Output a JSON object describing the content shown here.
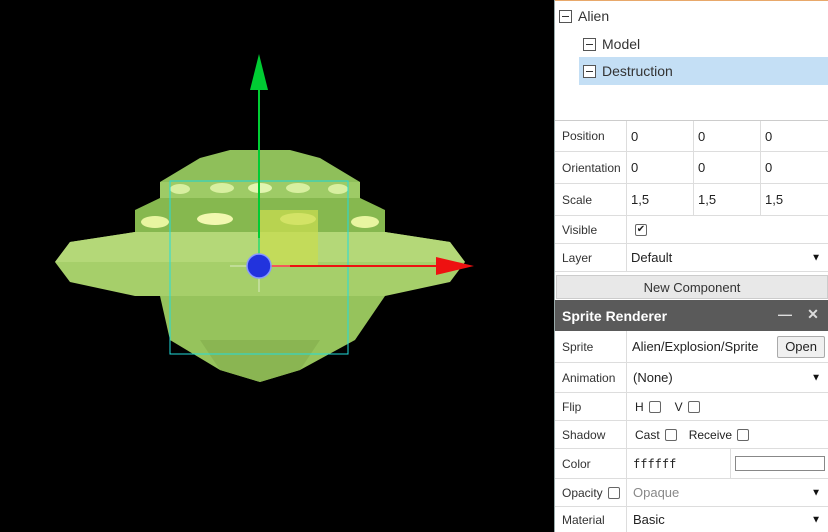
{
  "tree": {
    "items": [
      {
        "label": "Alien"
      },
      {
        "label": "Model"
      },
      {
        "label": "Destruction"
      }
    ]
  },
  "transform": {
    "position": {
      "label": "Position",
      "x": "0",
      "y": "0",
      "z": "0"
    },
    "orientation": {
      "label": "Orientation",
      "x": "0",
      "y": "0",
      "z": "0"
    },
    "scale": {
      "label": "Scale",
      "x": "1,5",
      "y": "1,5",
      "z": "1,5"
    },
    "visible": {
      "label": "Visible",
      "checked": true,
      "check_glyph": "✔"
    },
    "layer": {
      "label": "Layer",
      "value": "Default"
    }
  },
  "new_component_label": "New Component",
  "sprite_renderer": {
    "title": "Sprite Renderer",
    "minimize_glyph": "—",
    "close_glyph": "✕",
    "sprite": {
      "label": "Sprite",
      "value": "Alien/Explosion/Sprite",
      "open_label": "Open"
    },
    "animation": {
      "label": "Animation",
      "value": "(None)"
    },
    "flip": {
      "label": "Flip",
      "h_label": "H",
      "v_label": "V"
    },
    "shadow": {
      "label": "Shadow",
      "cast_label": "Cast",
      "receive_label": "Receive"
    },
    "color": {
      "label": "Color",
      "value": "ffffff",
      "swatch": "#ffffff"
    },
    "opacity": {
      "label": "Opacity",
      "placeholder": "Opaque"
    },
    "material": {
      "label": "Material",
      "value": "Basic"
    }
  },
  "dropdown_arrow": "▼",
  "colors": {
    "gizmo_up": "#00cc33",
    "gizmo_right": "#ee1111",
    "gizmo_center": "#2233dd",
    "selection_box": "#22dddd",
    "tree_selected": "#c4dff5",
    "header_bg": "#5a5a5a"
  }
}
